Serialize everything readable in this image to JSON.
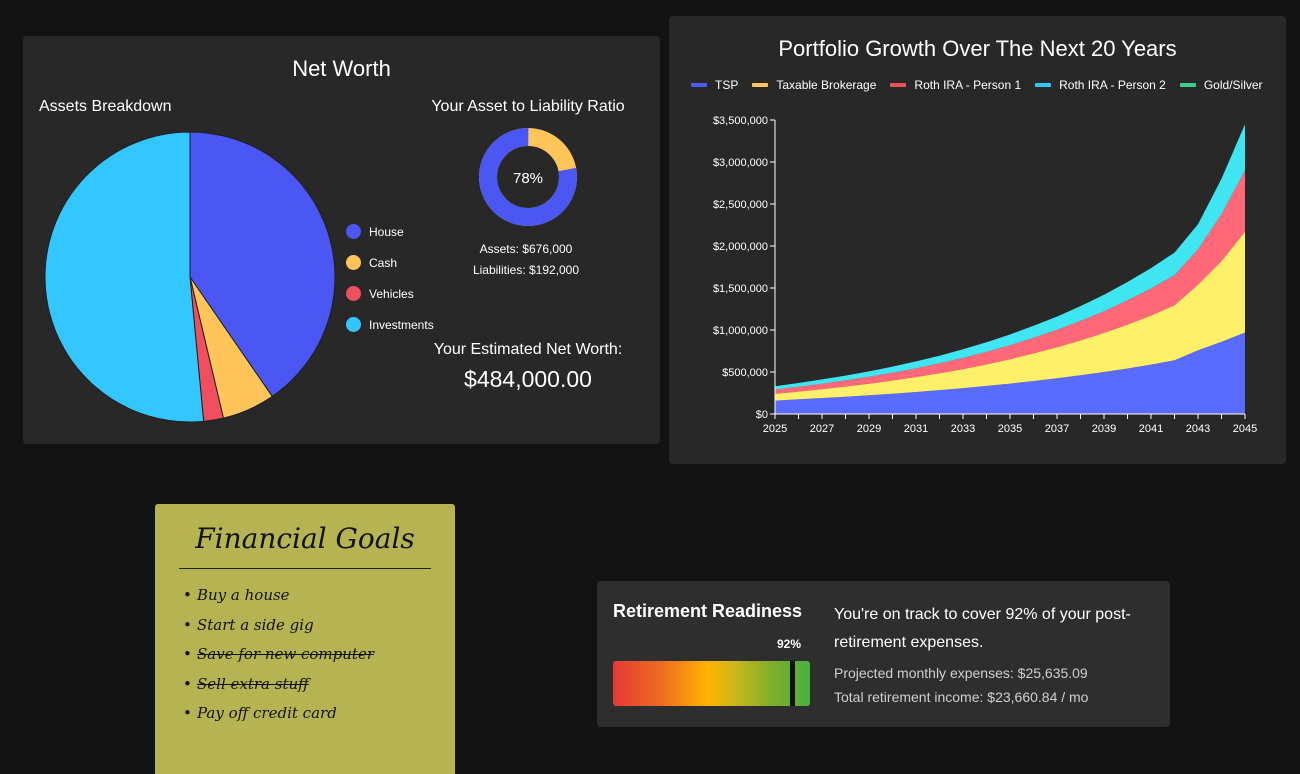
{
  "net_worth": {
    "title": "Net Worth",
    "assets_heading": "Assets Breakdown",
    "ratio_heading": "Your Asset to Liability Ratio",
    "ratio_percent": "78%",
    "ratio_value": 0.78,
    "assets_text": "Assets: $676,000",
    "liabilities_text": "Liabilities: $192,000",
    "estimated_label": "Your Estimated Net Worth:",
    "estimated_value": "$484,000.00",
    "legend": [
      {
        "label": "House",
        "color": "#4a57f2"
      },
      {
        "label": "Cash",
        "color": "#ffc55a"
      },
      {
        "label": "Vehicles",
        "color": "#f0505e"
      },
      {
        "label": "Investments",
        "color": "#33c6ff"
      }
    ],
    "pie_slices": [
      {
        "label": "House",
        "fraction": 0.404,
        "color": "#4a57f2"
      },
      {
        "label": "Cash",
        "fraction": 0.059,
        "color": "#ffc55a"
      },
      {
        "label": "Vehicles",
        "fraction": 0.022,
        "color": "#f0505e"
      },
      {
        "label": "Investments",
        "fraction": 0.515,
        "color": "#33c6ff"
      }
    ],
    "donut_colors": {
      "assets": "#4a57f2",
      "liabilities": "#ffc55a"
    }
  },
  "growth": {
    "title": "Portfolio Growth Over The Next 20 Years",
    "legend": [
      {
        "label": "TSP",
        "color": "#4a5cff"
      },
      {
        "label": "Taxable Brokerage",
        "color": "#ffc55a"
      },
      {
        "label": "Roth IRA - Person 1",
        "color": "#f0505e"
      },
      {
        "label": "Roth IRA - Person 2",
        "color": "#33c6ff"
      },
      {
        "label": "Gold/Silver",
        "color": "#3ccf8e"
      }
    ]
  },
  "chart_data": {
    "type": "area",
    "title": "Portfolio Growth Over The Next 20 Years",
    "stacked": true,
    "x": [
      2025,
      2026,
      2027,
      2028,
      2029,
      2030,
      2031,
      2032,
      2033,
      2034,
      2035,
      2036,
      2037,
      2038,
      2039,
      2040,
      2041,
      2042,
      2043,
      2044,
      2045
    ],
    "x_tick_labels": [
      "2025",
      "2027",
      "2029",
      "2031",
      "2033",
      "2035",
      "2037",
      "2039",
      "2041",
      "2043",
      "2045"
    ],
    "y_tick_labels": [
      "$0",
      "$500,000",
      "$1,000,000",
      "$1,500,000",
      "$2,000,000",
      "$2,500,000",
      "$3,000,000",
      "$3,500,000"
    ],
    "ylim": [
      0,
      3500000
    ],
    "series": [
      {
        "name": "TSP",
        "color": "#5a6cff",
        "values": [
          160000,
          175000,
          190000,
          206000,
          223000,
          242000,
          262000,
          284000,
          308000,
          334000,
          362000,
          393000,
          426000,
          462000,
          500000,
          542000,
          588000,
          640000,
          760000,
          860000,
          970000
        ]
      },
      {
        "name": "Taxable Brokerage",
        "color": "#fff06a",
        "values": [
          80000,
          92000,
          106000,
          121000,
          138000,
          157000,
          178000,
          201000,
          227000,
          256000,
          290000,
          328000,
          368000,
          414000,
          465000,
          522000,
          585000,
          655000,
          780000,
          960000,
          1200000
        ]
      },
      {
        "name": "Roth IRA - Person 1",
        "color": "#ff6878",
        "values": [
          50000,
          57000,
          65000,
          73000,
          82000,
          93000,
          105000,
          118000,
          133000,
          149000,
          167000,
          187000,
          208000,
          232000,
          259000,
          289000,
          322000,
          358000,
          420000,
          560000,
          730000
        ]
      },
      {
        "name": "Roth IRA - Person 2",
        "color": "#3fe6f2",
        "values": [
          40000,
          45000,
          51000,
          57000,
          64000,
          72000,
          81000,
          91000,
          102000,
          114000,
          127000,
          142000,
          158000,
          176000,
          196000,
          218000,
          242000,
          268000,
          300000,
          420000,
          550000
        ]
      },
      {
        "name": "Gold/Silver",
        "color": "#3ccf8e",
        "values": [
          0,
          0,
          0,
          0,
          0,
          0,
          0,
          0,
          0,
          0,
          0,
          0,
          0,
          0,
          0,
          0,
          0,
          0,
          0,
          0,
          0
        ]
      }
    ]
  },
  "goals": {
    "title": "Financial Goals",
    "items": [
      {
        "text": "Buy a house",
        "done": false
      },
      {
        "text": "Start a side gig",
        "done": false
      },
      {
        "text": "Save for new computer",
        "done": true
      },
      {
        "text": "Sell extra stuff",
        "done": true
      },
      {
        "text": "Pay off credit card",
        "done": false
      }
    ]
  },
  "readiness": {
    "title": "Retirement Readiness",
    "percent_label": "92%",
    "percent_value": 0.92,
    "message": "You're on track to cover 92% of your post-retirement expenses.",
    "projected": "Projected monthly expenses: $25,635.09",
    "income": "Total retirement income: $23,660.84 / mo"
  }
}
